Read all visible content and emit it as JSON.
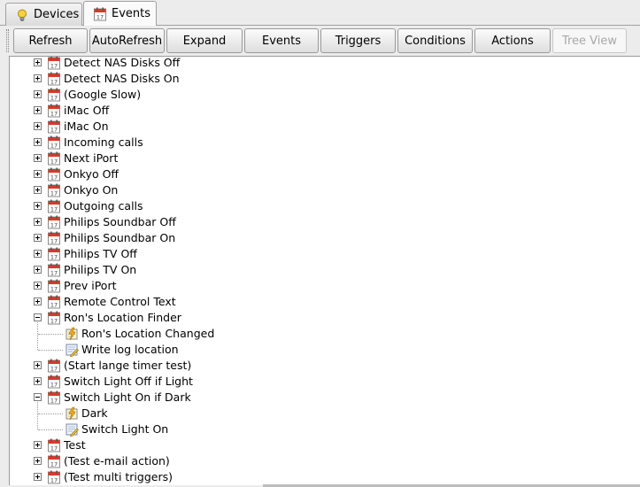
{
  "tabs": [
    {
      "label": "Devices",
      "icon": "lightbulb-icon",
      "active": false
    },
    {
      "label": "Events",
      "icon": "calendar-icon",
      "active": true
    }
  ],
  "toolbar": {
    "buttons": [
      {
        "label": "Refresh",
        "enabled": true
      },
      {
        "label": "AutoRefresh",
        "enabled": true
      },
      {
        "label": "Expand",
        "enabled": true
      },
      {
        "label": "Events",
        "enabled": true
      },
      {
        "label": "Triggers",
        "enabled": true
      },
      {
        "label": "Conditions",
        "enabled": true
      },
      {
        "label": "Actions",
        "enabled": true
      },
      {
        "label": "Tree View",
        "enabled": false
      }
    ]
  },
  "tree": {
    "items": [
      {
        "label": "Detect NAS Disks Off",
        "level": 0,
        "type": "event",
        "expanded": false
      },
      {
        "label": "Detect NAS Disks On",
        "level": 0,
        "type": "event",
        "expanded": false
      },
      {
        "label": "(Google Slow)",
        "level": 0,
        "type": "event",
        "expanded": false
      },
      {
        "label": "iMac Off",
        "level": 0,
        "type": "event",
        "expanded": false
      },
      {
        "label": "iMac On",
        "level": 0,
        "type": "event",
        "expanded": false
      },
      {
        "label": "Incoming calls",
        "level": 0,
        "type": "event",
        "expanded": false
      },
      {
        "label": "Next iPort",
        "level": 0,
        "type": "event",
        "expanded": false
      },
      {
        "label": "Onkyo Off",
        "level": 0,
        "type": "event",
        "expanded": false
      },
      {
        "label": "Onkyo On",
        "level": 0,
        "type": "event",
        "expanded": false
      },
      {
        "label": "Outgoing calls",
        "level": 0,
        "type": "event",
        "expanded": false
      },
      {
        "label": "Philips Soundbar Off",
        "level": 0,
        "type": "event",
        "expanded": false
      },
      {
        "label": "Philips Soundbar On",
        "level": 0,
        "type": "event",
        "expanded": false
      },
      {
        "label": "Philips TV Off",
        "level": 0,
        "type": "event",
        "expanded": false
      },
      {
        "label": "Philips TV On",
        "level": 0,
        "type": "event",
        "expanded": false
      },
      {
        "label": "Prev iPort",
        "level": 0,
        "type": "event",
        "expanded": false
      },
      {
        "label": "Remote Control Text",
        "level": 0,
        "type": "event",
        "expanded": false
      },
      {
        "label": "Ron's Location Finder",
        "level": 0,
        "type": "event",
        "expanded": true
      },
      {
        "label": "Ron's Location Changed",
        "level": 1,
        "type": "trigger"
      },
      {
        "label": "Write log location",
        "level": 1,
        "type": "action"
      },
      {
        "label": "(Start lange timer test)",
        "level": 0,
        "type": "event",
        "expanded": false
      },
      {
        "label": "Switch Light Off if Light",
        "level": 0,
        "type": "event",
        "expanded": false
      },
      {
        "label": "Switch Light On if Dark",
        "level": 0,
        "type": "event",
        "expanded": true
      },
      {
        "label": "Dark",
        "level": 1,
        "type": "trigger"
      },
      {
        "label": "Switch Light On",
        "level": 1,
        "type": "action"
      },
      {
        "label": "Test",
        "level": 0,
        "type": "event",
        "expanded": false
      },
      {
        "label": "(Test e-mail action)",
        "level": 0,
        "type": "event",
        "expanded": false
      },
      {
        "label": "(Test multi triggers)",
        "level": 0,
        "type": "event",
        "expanded": false
      }
    ]
  }
}
